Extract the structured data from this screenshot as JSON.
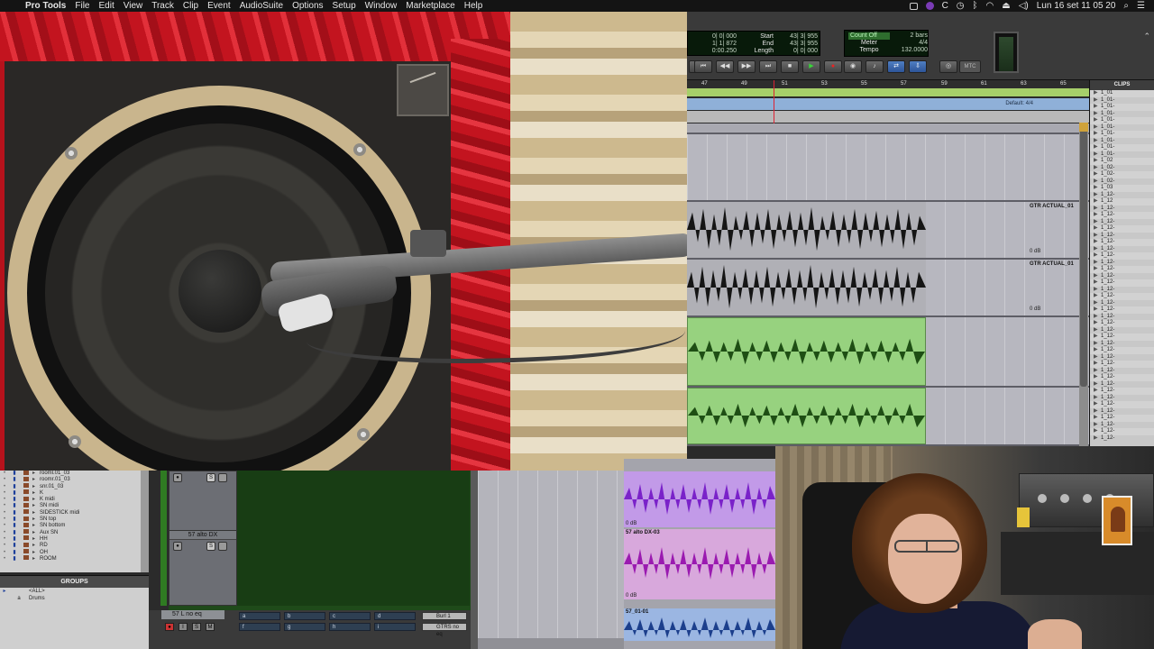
{
  "menubar": {
    "app_name": "Pro Tools",
    "menus": [
      "File",
      "Edit",
      "View",
      "Track",
      "Clip",
      "Event",
      "AudioSuite",
      "Options",
      "Setup",
      "Window",
      "Marketplace",
      "Help"
    ],
    "clock": "Lun 16 set  11 05 20"
  },
  "transport": {
    "counter": {
      "main_rows": [
        "0| 0| 000",
        "1| 1| 872",
        "0:00.250"
      ],
      "labels": [
        "Start",
        "End",
        "Length"
      ],
      "values": [
        "43| 3| 955",
        "43| 3| 955",
        "0| 0| 000"
      ]
    },
    "meter": {
      "count_off": "Count Off",
      "count_value": "2 bars",
      "meter_label": "Meter",
      "meter_value": "4/4",
      "tempo_label": "Tempo",
      "tempo_value": "132.0000"
    },
    "mtc": "MTC"
  },
  "ruler": {
    "bars": [
      "47",
      "49",
      "51",
      "53",
      "55",
      "57",
      "59",
      "61",
      "63",
      "65"
    ],
    "meter_marker": "Default: 4/4"
  },
  "tracks": [
    {
      "clip_name": "GTR ACTUAL_01",
      "gain": "0 dB"
    },
    {
      "clip_name": "GTR ACTUAL_01",
      "gain": "0 dB"
    }
  ],
  "clips_panel": {
    "title": "CLIPS",
    "items": [
      "1_01",
      "1_01-",
      "1_01-",
      "1_01-",
      "1_01-",
      "1_01-",
      "1_01-",
      "1_01-",
      "1_01-",
      "1_01-",
      "1_02",
      "1_02-",
      "1_02-",
      "1_02-",
      "1_03",
      "1_12-",
      "1_12",
      "1_12-",
      "1_12-",
      "1_12-",
      "1_12-",
      "1_12-",
      "1_12-",
      "1_12-",
      "1_12-",
      "1_12-",
      "1_12-",
      "1_12-",
      "1_12-",
      "1_12-",
      "1_12-",
      "1_12-",
      "1_12-",
      "1_12-",
      "1_12-",
      "1_12-",
      "1_12-",
      "1_12-",
      "1_12-",
      "1_12-",
      "1_12-",
      "1_12-",
      "1_12-",
      "1_12-",
      "1_12-",
      "1_12-",
      "1_12-",
      "1_12-",
      "1_12-",
      "1_12-",
      "1_12-",
      "1_12-"
    ]
  },
  "region_list": {
    "items": [
      "rooml.01_03",
      "roomr.01_03",
      "snr.01_03",
      "K",
      "K midi",
      "SN midi",
      "SIDESTICK midi",
      "SN top",
      "SN bottom",
      "Aux SN",
      "HH",
      "RD",
      "OH",
      "ROOM"
    ]
  },
  "groups": {
    "title": "GROUPS",
    "items": [
      "<ALL>",
      "Drums"
    ]
  },
  "mixer": {
    "strip1_btn_s": "S",
    "strip2_name": "57 alto DX",
    "strip2_btn_s": "S",
    "bottom_track_name": "57 L no eq",
    "bus_1": "Burl 1",
    "bus_2": "GTRS no eq",
    "btn_m": "M"
  },
  "bottom_clips": [
    {
      "name": "",
      "gain": "0 dB"
    },
    {
      "name": "57 alto DX-03",
      "gain": "0 dB"
    },
    {
      "name": "57_01-01",
      "gain": ""
    }
  ],
  "colors": {
    "accent_green": "#a6cf6a",
    "green_clip": "#8fd07a",
    "purple_clip": "#b47be3",
    "blue_clip": "#8fa9d8",
    "record_red": "#e22222"
  }
}
